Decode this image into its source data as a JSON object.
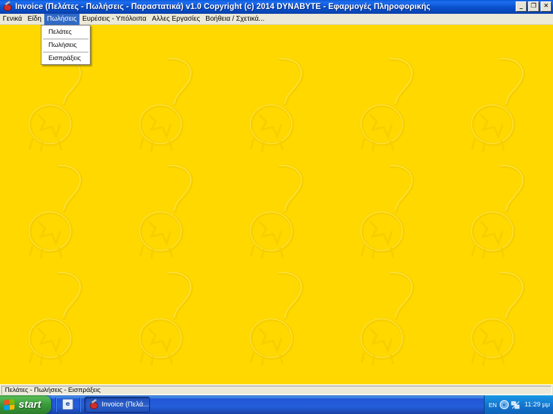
{
  "window": {
    "title": "Invoice (Πελάτες - Πωλήσεις - Παραστατικά)  v1.0   Copyright (c) 2014  DYNABYTE - Εφαρμογές Πληροφορικής",
    "minimize": "_",
    "restore": "❐",
    "close": "✕"
  },
  "menu": {
    "items": [
      "Γενικά",
      "Είδη",
      "Πωλήσεις",
      "Ευρέσεις - Υπόλοιπα",
      "Αλλες Εργασίες",
      "Βοήθεια / Σχετικά..."
    ],
    "active": "Πωλήσεις"
  },
  "dropdown": {
    "items": [
      "Πελάτες",
      "Πωλήσεις",
      "Εισπράξεις"
    ]
  },
  "status": {
    "text": "Πελάτες - Πωλήσεις - Εισπράξεις"
  },
  "taskbar": {
    "start_label": "start",
    "task_label": "Invoice (Πελά...",
    "lang": "EN",
    "tray_expand": "«",
    "clock": "11:29 μμ"
  },
  "colors": {
    "workspace": "#ffd800",
    "menu_highlight": "#316ac5"
  }
}
